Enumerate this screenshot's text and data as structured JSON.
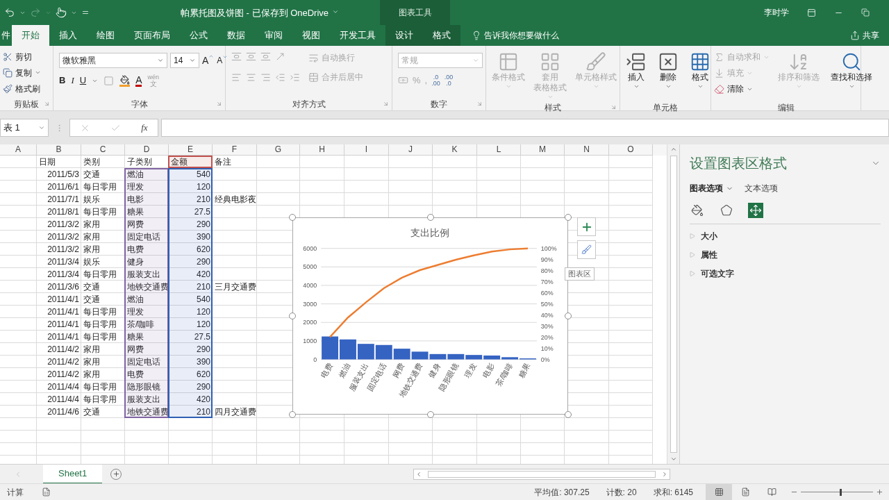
{
  "title_bar": {
    "title": "帕累托图及饼图 - 已保存到 OneDrive",
    "context_title": "图表工具",
    "user": "李时学"
  },
  "tabs": [
    {
      "label": "件",
      "kind": "file",
      "selected": false
    },
    {
      "label": "开始",
      "kind": "main",
      "selected": true
    },
    {
      "label": "插入",
      "kind": "main",
      "selected": false
    },
    {
      "label": "绘图",
      "kind": "main",
      "selected": false
    },
    {
      "label": "页面布局",
      "kind": "main",
      "selected": false
    },
    {
      "label": "公式",
      "kind": "main",
      "selected": false
    },
    {
      "label": "数据",
      "kind": "main",
      "selected": false
    },
    {
      "label": "审阅",
      "kind": "main",
      "selected": false
    },
    {
      "label": "视图",
      "kind": "main",
      "selected": false
    },
    {
      "label": "开发工具",
      "kind": "main",
      "selected": false
    },
    {
      "label": "设计",
      "kind": "context",
      "selected": false
    },
    {
      "label": "格式",
      "kind": "context",
      "selected": false
    }
  ],
  "tell_me": "告诉我你想要做什么",
  "share": "共享",
  "ribbon": {
    "clipboard": {
      "label": "剪贴板",
      "items": [
        {
          "label": "剪切",
          "kind": "cut"
        },
        {
          "label": "复制",
          "kind": "copy"
        },
        {
          "label": "格式刷",
          "kind": "painter"
        }
      ]
    },
    "font": {
      "label": "字体",
      "font_name": "微软雅黑",
      "font_size": "14",
      "grow": "A",
      "shrink": "A",
      "styles": [
        "B",
        "I",
        "U"
      ],
      "font_color": "A",
      "phonetic": [
        "wén",
        "文"
      ]
    },
    "alignment": {
      "label": "对齐方式",
      "disabled": true,
      "items": [
        {
          "label": "自动换行",
          "kind": "wrap"
        },
        {
          "label": "合并后居中",
          "kind": "merge"
        }
      ]
    },
    "number": {
      "label": "数字",
      "format": "常规",
      "symbols": [
        "%",
        ","
      ],
      "decimals": [
        [
          ".0",
          ".00"
        ],
        [
          ".00",
          ".0"
        ]
      ]
    },
    "styles": {
      "label": "样式",
      "items": [
        {
          "lines": [
            "条件格式"
          ],
          "kind": "conditional",
          "disabled": true
        },
        {
          "lines": [
            "套用",
            "表格格式"
          ],
          "kind": "table",
          "disabled": true
        },
        {
          "lines": [
            "单元格样式"
          ],
          "kind": "cellstyle",
          "disabled": true
        }
      ]
    },
    "cells": {
      "label": "单元格",
      "items": [
        {
          "lines": [
            "插入"
          ],
          "kind": "insert",
          "disabled": false
        },
        {
          "lines": [
            "删除"
          ],
          "kind": "delete",
          "disabled": false
        },
        {
          "lines": [
            "格式"
          ],
          "kind": "format",
          "disabled": false
        }
      ]
    },
    "editing": {
      "label": "编辑",
      "small": [
        {
          "label": "自动求和",
          "kind": "sum",
          "disabled": true
        },
        {
          "label": "填充",
          "kind": "fill",
          "disabled": true
        },
        {
          "label": "清除",
          "kind": "clear",
          "disabled": false
        }
      ],
      "large": [
        {
          "lines": [
            "排序和筛选"
          ],
          "kind": "sort",
          "disabled": true
        },
        {
          "lines": [
            "查找和选择"
          ],
          "kind": "find",
          "disabled": false
        }
      ]
    }
  },
  "formula_bar": {
    "name_box": "表 1",
    "fx": "fx"
  },
  "sheet": {
    "columns": [
      {
        "label": "A"
      },
      {
        "label": "B"
      },
      {
        "label": "C"
      },
      {
        "label": "D",
        "data_range": {
          "color": "#8064a2"
        }
      },
      {
        "label": "E",
        "data_range": {
          "color": "#2f5fb3"
        },
        "header_range": {
          "color": "#c0504d"
        }
      },
      {
        "label": "F"
      },
      {
        "label": "G"
      },
      {
        "label": "H"
      },
      {
        "label": "I"
      },
      {
        "label": "J"
      },
      {
        "label": "K"
      },
      {
        "label": "L"
      },
      {
        "label": "M"
      },
      {
        "label": "N"
      },
      {
        "label": "O"
      }
    ],
    "headers": [
      "日期",
      "类别",
      "子类别",
      "金额",
      "备注"
    ],
    "rows": [
      {
        "date": "2011/5/3",
        "category": "交通",
        "subcategory": "燃油",
        "amount": "540"
      },
      {
        "date": "2011/6/1",
        "category": "每日零用",
        "subcategory": "理发",
        "amount": "120"
      },
      {
        "date": "2011/7/1",
        "category": "娱乐",
        "subcategory": "电影",
        "amount": "210",
        "note": "经典电影夜"
      },
      {
        "date": "2011/8/1",
        "category": "每日零用",
        "subcategory": "糖果",
        "amount": "27.5"
      },
      {
        "date": "2011/3/2",
        "category": "家用",
        "subcategory": "网费",
        "amount": "290"
      },
      {
        "date": "2011/3/2",
        "category": "家用",
        "subcategory": "固定电话",
        "amount": "390"
      },
      {
        "date": "2011/3/2",
        "category": "家用",
        "subcategory": "电费",
        "amount": "620"
      },
      {
        "date": "2011/3/4",
        "category": "娱乐",
        "subcategory": "健身",
        "amount": "290"
      },
      {
        "date": "2011/3/4",
        "category": "每日零用",
        "subcategory": "服装支出",
        "amount": "420"
      },
      {
        "date": "2011/3/6",
        "category": "交通",
        "subcategory": "地铁交通费",
        "amount": "210",
        "note": "三月交通费"
      },
      {
        "date": "2011/4/1",
        "category": "交通",
        "subcategory": "燃油",
        "amount": "540"
      },
      {
        "date": "2011/4/1",
        "category": "每日零用",
        "subcategory": "理发",
        "amount": "120"
      },
      {
        "date": "2011/4/1",
        "category": "每日零用",
        "subcategory": "茶/咖啡",
        "amount": "120"
      },
      {
        "date": "2011/4/1",
        "category": "每日零用",
        "subcategory": "糖果",
        "amount": "27.5"
      },
      {
        "date": "2011/4/2",
        "category": "家用",
        "subcategory": "网费",
        "amount": "290"
      },
      {
        "date": "2011/4/2",
        "category": "家用",
        "subcategory": "固定电话",
        "amount": "390"
      },
      {
        "date": "2011/4/2",
        "category": "家用",
        "subcategory": "电费",
        "amount": "620"
      },
      {
        "date": "2011/4/4",
        "category": "每日零用",
        "subcategory": "隐形眼镜",
        "amount": "290"
      },
      {
        "date": "2011/4/4",
        "category": "每日零用",
        "subcategory": "服装支出",
        "amount": "420"
      },
      {
        "date": "2011/4/6",
        "category": "交通",
        "subcategory": "地铁交通费",
        "amount": "210",
        "note": "四月交通费"
      }
    ]
  },
  "chart": {
    "tooltip": "图表区",
    "chart_data": {
      "type": "bar",
      "title": "支出比例",
      "categories": [
        "电费",
        "燃油",
        "服装支出",
        "固定电话",
        "网费",
        "地铁交通费",
        "健身",
        "隐形眼镜",
        "理发",
        "电影",
        "茶/咖啡",
        "糖果"
      ],
      "series": [
        {
          "type": "bar",
          "color": "#3563c2",
          "values": [
            1240,
            1080,
            840,
            780,
            580,
            420,
            290,
            290,
            240,
            210,
            120,
            55
          ]
        },
        {
          "type": "line",
          "axis": "y2",
          "color": "#ed7d31",
          "values": [
            0.2018,
            0.3775,
            0.5142,
            0.6412,
            0.7356,
            0.8039,
            0.8511,
            0.8983,
            0.9373,
            0.9715,
            0.991,
            1
          ]
        }
      ],
      "grid": true,
      "ylim": [
        0,
        6000
      ],
      "y2lim": [
        0,
        1
      ],
      "yticks": [
        0,
        1000,
        2000,
        3000,
        4000,
        5000,
        6000
      ],
      "y2ticks": [
        {
          "value": 0,
          "label": "0%"
        },
        {
          "value": 0.1,
          "label": "10%"
        },
        {
          "value": 0.2,
          "label": "20%"
        },
        {
          "value": 0.3,
          "label": "30%"
        },
        {
          "value": 0.4,
          "label": "40%"
        },
        {
          "value": 0.5,
          "label": "50%"
        },
        {
          "value": 0.6,
          "label": "60%"
        },
        {
          "value": 0.7,
          "label": "70%"
        },
        {
          "value": 0.8,
          "label": "80%"
        },
        {
          "value": 0.9,
          "label": "90%"
        },
        {
          "value": 1,
          "label": "100%"
        }
      ]
    }
  },
  "format_pane": {
    "title": "设置图表区格式",
    "tabs": [
      {
        "label": "图表选项",
        "selected": true
      },
      {
        "label": "文本选项",
        "selected": false
      }
    ],
    "icon_tabs": [
      {
        "kind": "fill",
        "selected": false
      },
      {
        "kind": "effects",
        "selected": false
      },
      {
        "kind": "size",
        "selected": true
      }
    ],
    "sections": [
      {
        "label": "大小",
        "expanded": false
      },
      {
        "label": "属性",
        "expanded": false
      },
      {
        "label": "可选文字",
        "expanded": false
      }
    ]
  },
  "sheet_tabs": [
    {
      "label": "Sheet1",
      "selected": true
    }
  ],
  "status_bar": {
    "mode": "计算",
    "stats": [
      "平均值: 307.25",
      "计数: 20",
      "求和: 6145"
    ],
    "views": [
      {
        "kind": "normal",
        "selected": true
      },
      {
        "kind": "page_layout",
        "selected": false
      },
      {
        "kind": "page_break",
        "selected": false
      }
    ],
    "zoom": {
      "level": 0.55
    }
  }
}
